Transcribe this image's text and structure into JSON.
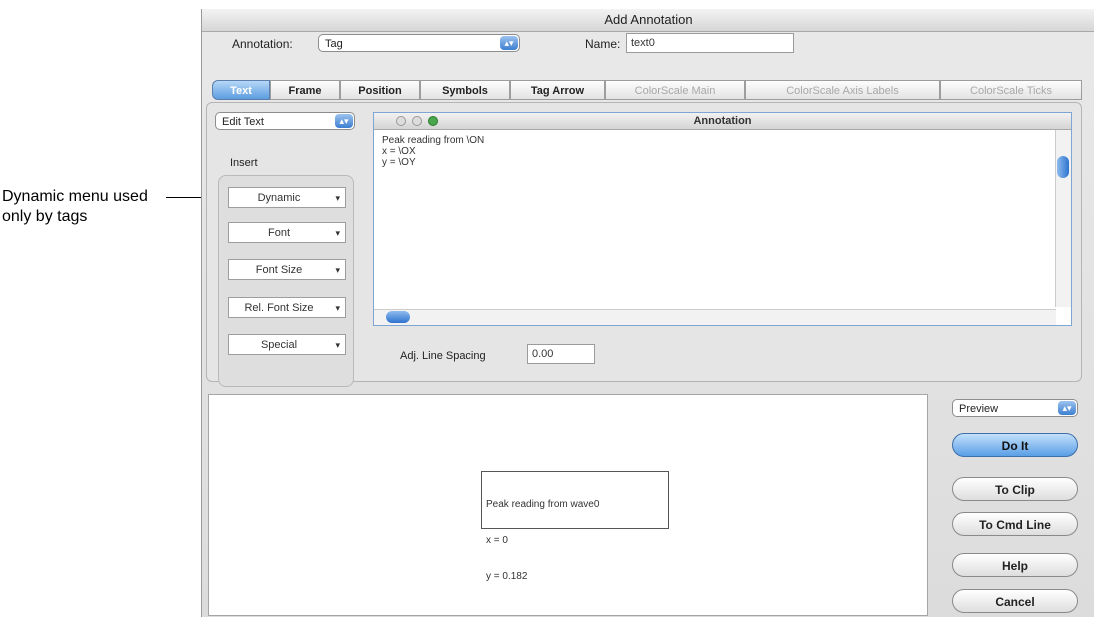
{
  "callout": {
    "text": "Dynamic menu used only by tags"
  },
  "dialog": {
    "title": "Add Annotation",
    "annotation_label": "Annotation:",
    "annotation_type": "Tag",
    "name_label": "Name:",
    "name_value": "text0"
  },
  "tabs": [
    {
      "label": "Text",
      "state": "active"
    },
    {
      "label": "Frame",
      "state": "enabled"
    },
    {
      "label": "Position",
      "state": "enabled"
    },
    {
      "label": "Symbols",
      "state": "enabled"
    },
    {
      "label": "Tag Arrow",
      "state": "enabled"
    },
    {
      "label": "ColorScale Main",
      "state": "disabled"
    },
    {
      "label": "ColorScale Axis Labels",
      "state": "disabled"
    },
    {
      "label": "ColorScale Ticks",
      "state": "disabled"
    }
  ],
  "text_tab": {
    "mode_select": "Edit Text",
    "insert_label": "Insert",
    "insert_buttons": [
      "Dynamic",
      "Font",
      "Font Size",
      "Rel. Font Size",
      "Special"
    ],
    "editor_title": "Annotation",
    "editor_lines": [
      "Peak reading from \\ON",
      "x = \\OX",
      "y = \\OY"
    ],
    "line_spacing_label": "Adj. Line Spacing",
    "line_spacing_value": "0.00"
  },
  "preview": {
    "lines": [
      "Peak reading from wave0",
      "x = 0",
      "y = 0.182"
    ],
    "mode_select": "Preview"
  },
  "buttons": {
    "do_it": "Do It",
    "to_clip": "To Clip",
    "to_cmd_line": "To Cmd Line",
    "help": "Help",
    "cancel": "Cancel"
  }
}
